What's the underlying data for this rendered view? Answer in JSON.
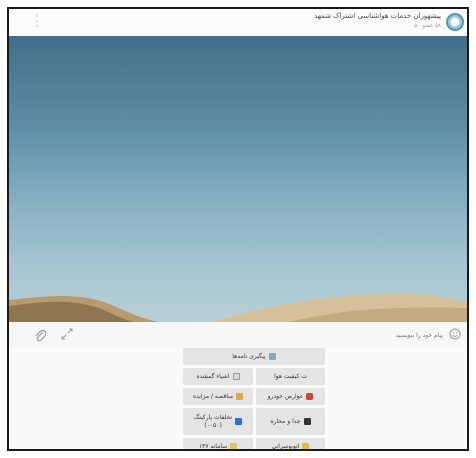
{
  "header": {
    "channel_title": "پیشهوران خدمات هواشناسی اشتراک شمهد",
    "channel_subtitle": "۵۸ عضو · ۵",
    "menu_icon": "more-vertical-icon",
    "logo_icon": "channel-logo"
  },
  "photo": {
    "description_icon": "desert-sky-photo",
    "sky_color": "#5c8ca6",
    "sand_color": "#c9b18c"
  },
  "caption": {
    "placeholder": "پیام خود را بنویسید",
    "attach_icon": "paperclip-icon",
    "expand_icon": "expand-icon",
    "emoji_icon": "smile-icon"
  },
  "keyboard": {
    "buttons": [
      {
        "label": "پیگیری نامه‌ها",
        "icon": "mail-icon"
      },
      {
        "label": "ت کیفیت هوا",
        "icon": ""
      },
      {
        "label": "اشیاء گمشده",
        "icon": "search-icon"
      },
      {
        "label": "عوارض خودرو",
        "icon": "car-icon"
      },
      {
        "label": "مناقصه / مزایده",
        "icon": "megaphone-icon"
      },
      {
        "label": "جدا و مخاره",
        "icon": "flag-icon"
      },
      {
        "label": "تخلفات پارکینگ\n(۰۰۵۰)",
        "icon": "parking-icon"
      },
      {
        "label": "اتوبوسرانی",
        "icon": "bus-icon"
      },
      {
        "label": "سامانه ۱۳۷",
        "icon": "wrench-icon"
      }
    ]
  }
}
